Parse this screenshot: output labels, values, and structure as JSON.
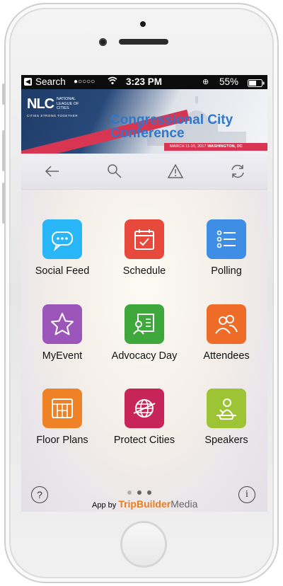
{
  "status_bar": {
    "back_label": "Search",
    "signal": "●○○○○",
    "time": "3:23 PM",
    "battery": "55%"
  },
  "banner": {
    "org_short": "NLC",
    "org_name": "NATIONAL LEAGUE OF CITIES",
    "tagline": "CITIES STRONG TOGETHER",
    "title_line1": "Congressional City",
    "title_line2": "Conference",
    "date": "MARCH 11-15, 2017",
    "location": "WASHINGTON, DC"
  },
  "toolbar": {
    "icons": [
      "back-arrow-icon",
      "search-icon",
      "alert-icon",
      "refresh-icon"
    ]
  },
  "tiles": [
    {
      "label": "Social Feed",
      "color": "#29b6f6",
      "icon": "chat-bubbles-icon"
    },
    {
      "label": "Schedule",
      "color": "#e8493d",
      "icon": "calendar-icon"
    },
    {
      "label": "Polling",
      "color": "#3e8ee6",
      "icon": "list-icon"
    },
    {
      "label": "MyEvent",
      "color": "#9c55b8",
      "icon": "star-icon"
    },
    {
      "label": "Advocacy Day",
      "color": "#3ea83c",
      "icon": "document-person-icon"
    },
    {
      "label": "Attendees",
      "color": "#ef6b28",
      "icon": "people-icon"
    },
    {
      "label": "Floor Plans",
      "color": "#ef8227",
      "icon": "floor-plan-icon"
    },
    {
      "label": "Protect Cities",
      "color": "#c7245a",
      "icon": "globe-icon"
    },
    {
      "label": "Speakers",
      "color": "#9cc434",
      "icon": "speaker-podium-icon"
    }
  ],
  "pager": {
    "pages": 3,
    "active": 1
  },
  "footer": {
    "prefix": "App by",
    "brand_primary": "TripBuilder",
    "brand_secondary": "Media",
    "help_symbol": "?",
    "info_symbol": "i"
  }
}
